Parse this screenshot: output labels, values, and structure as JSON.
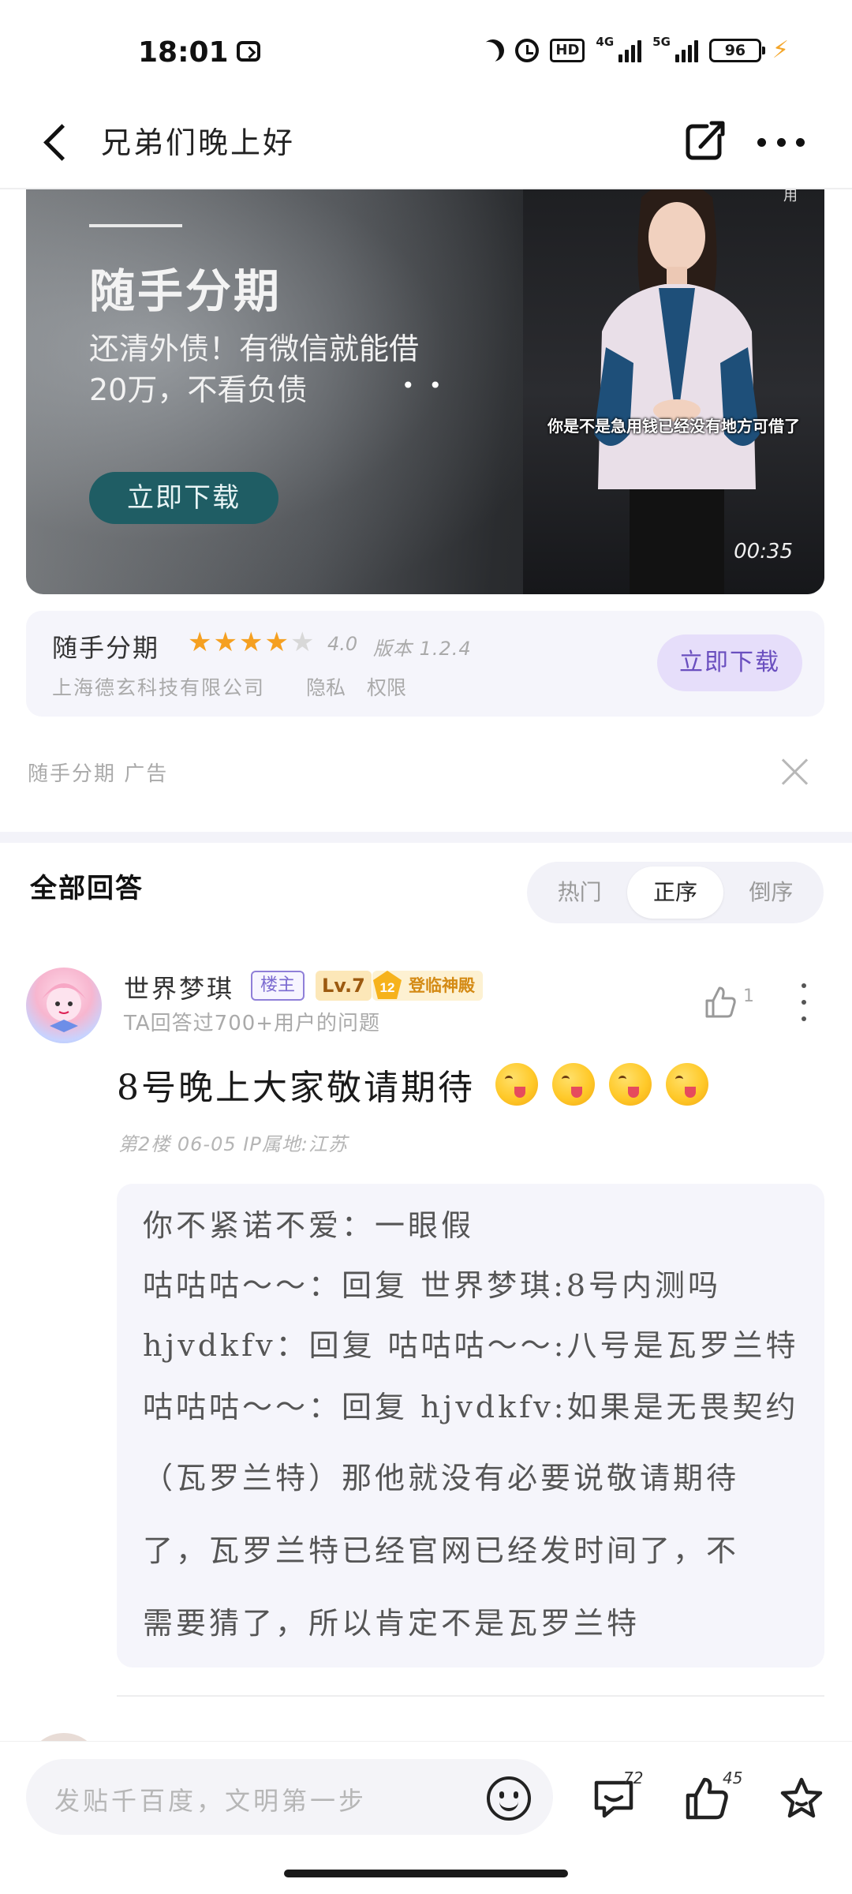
{
  "status_bar": {
    "time": "18:01",
    "hd_label": "HD",
    "net_1": "4G",
    "net_2": "5G",
    "battery": "96"
  },
  "header": {
    "title": "兄弟们晚上好",
    "share_icon": "share-edit-icon",
    "more_icon": "more-icon"
  },
  "ad": {
    "title": "随手分期",
    "desc_line1": "还清外债！有微信就能借",
    "desc_line2": "20万，不看负债",
    "download_label": "立即下载",
    "video_caption": "你是不是急用钱已经没有地方可借了",
    "video_duration": "00:35",
    "video_corner": "用"
  },
  "app_card": {
    "name": "随手分期",
    "rating_value": 4.0,
    "rating_label": "4.0",
    "version": "版本 1.2.4",
    "company": "上海德玄科技有限公司",
    "privacy": "隐私",
    "permissions": "权限",
    "download_label": "立即下载"
  },
  "ad_footer": {
    "label": "随手分期  广告"
  },
  "answers": {
    "section_title": "全部回答",
    "sort_tabs": [
      {
        "label": "热门",
        "active": false
      },
      {
        "label": "正序",
        "active": true
      },
      {
        "label": "倒序",
        "active": false
      }
    ]
  },
  "post": {
    "user_name": "世界梦琪",
    "host_badge": "楼主",
    "level": "Lv.7",
    "title_num": "12",
    "title_badge": "登临神殿",
    "user_sub": "TA回答过700+用户的问题",
    "like_count": "1",
    "content": "8号晚上大家敬请期待",
    "emoji_count": 4,
    "meta": "第2楼  06-05  IP属地:江苏",
    "replies": [
      "你不紧诺不爱：一眼假",
      "咕咕咕～～：回复 世界梦琪:8号内测吗",
      "hjvdkfv：回复 咕咕咕～～:八号是瓦罗兰特",
      "咕咕咕～～：回复 hjvdkfv:如果是无畏契约",
      "（瓦罗兰特）那他就没有必要说敬请期待",
      "了，瓦罗兰特已经官网已经发时间了，不",
      "需要猜了，所以肯定不是瓦罗兰特"
    ]
  },
  "bottom_bar": {
    "input_placeholder": "发贴千百度，文明第一步",
    "comment_count": "72",
    "like_count": "45"
  },
  "colors": {
    "accent_purple": "#6a4fbf",
    "star": "#f5a021",
    "ad_button": "#1f5d64"
  }
}
